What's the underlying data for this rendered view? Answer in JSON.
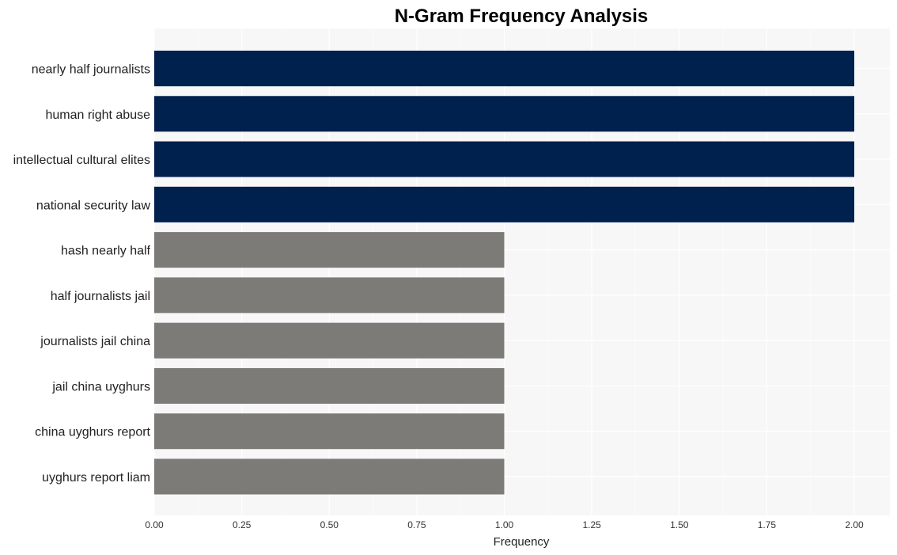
{
  "chart_data": {
    "type": "bar",
    "orientation": "horizontal",
    "title": "N-Gram Frequency Analysis",
    "xlabel": "Frequency",
    "ylabel": "",
    "xlim": [
      0,
      2.1
    ],
    "xticks": [
      "0.00",
      "0.25",
      "0.50",
      "0.75",
      "1.00",
      "1.25",
      "1.50",
      "1.75",
      "2.00"
    ],
    "xtick_values": [
      0,
      0.25,
      0.5,
      0.75,
      1.0,
      1.25,
      1.5,
      1.75,
      2.0
    ],
    "grid": true,
    "categories": [
      "nearly half journalists",
      "human right abuse",
      "intellectual cultural elites",
      "national security law",
      "hash nearly half",
      "half journalists jail",
      "journalists jail china",
      "jail china uyghurs",
      "china uyghurs report",
      "uyghurs report liam"
    ],
    "values": [
      2,
      2,
      2,
      2,
      1,
      1,
      1,
      1,
      1,
      1
    ],
    "colors": {
      "high": "#00204e",
      "low": "#7c7b77",
      "plot_background": "#f7f7f7",
      "grid": "#ffffff"
    }
  }
}
